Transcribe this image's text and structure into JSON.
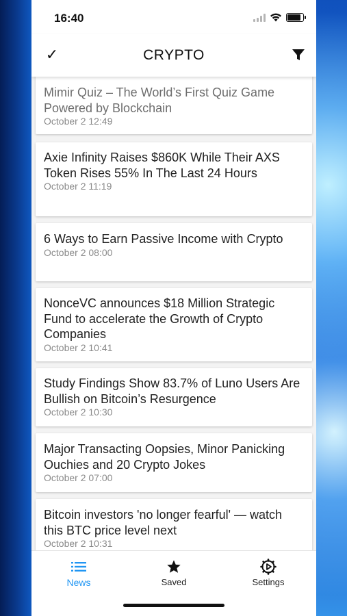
{
  "status": {
    "time": "16:40"
  },
  "appbar": {
    "title": "CRYPTO",
    "left_icon": "check-icon",
    "right_icon": "filter-icon"
  },
  "articles": [
    {
      "headline": "Mimir Quiz – The World’s First Quiz Game Powered by Blockchain",
      "date": "October 2 12:49"
    },
    {
      "headline": "Axie Infinity Raises $860K While Their AXS Token Rises 55% In The Last 24 Hours",
      "date": "October 2 11:19"
    },
    {
      "headline": "6 Ways to Earn Passive Income with Crypto",
      "date": "October 2 08:00"
    },
    {
      "headline": "NonceVC announces $18 Million Strategic Fund to accelerate the Growth of Crypto Companies",
      "date": "October 2 10:41"
    },
    {
      "headline": "Study Findings Show 83.7% of Luno Users Are Bullish on Bitcoin’s Resurgence",
      "date": "October 2 10:30"
    },
    {
      "headline": "Major Transacting Oopsies, Minor Panicking Ouchies and 20 Crypto Jokes",
      "date": "October 2 07:00"
    },
    {
      "headline": "Bitcoin investors 'no longer fearful' — watch this BTC price level next",
      "date": "October 2 10:31"
    }
  ],
  "tabs": [
    {
      "label": "News",
      "icon": "list-icon",
      "active": true
    },
    {
      "label": "Saved",
      "icon": "star-icon",
      "active": false
    },
    {
      "label": "Settings",
      "icon": "gear-icon",
      "active": false
    }
  ],
  "colors": {
    "accent": "#2196f3"
  }
}
